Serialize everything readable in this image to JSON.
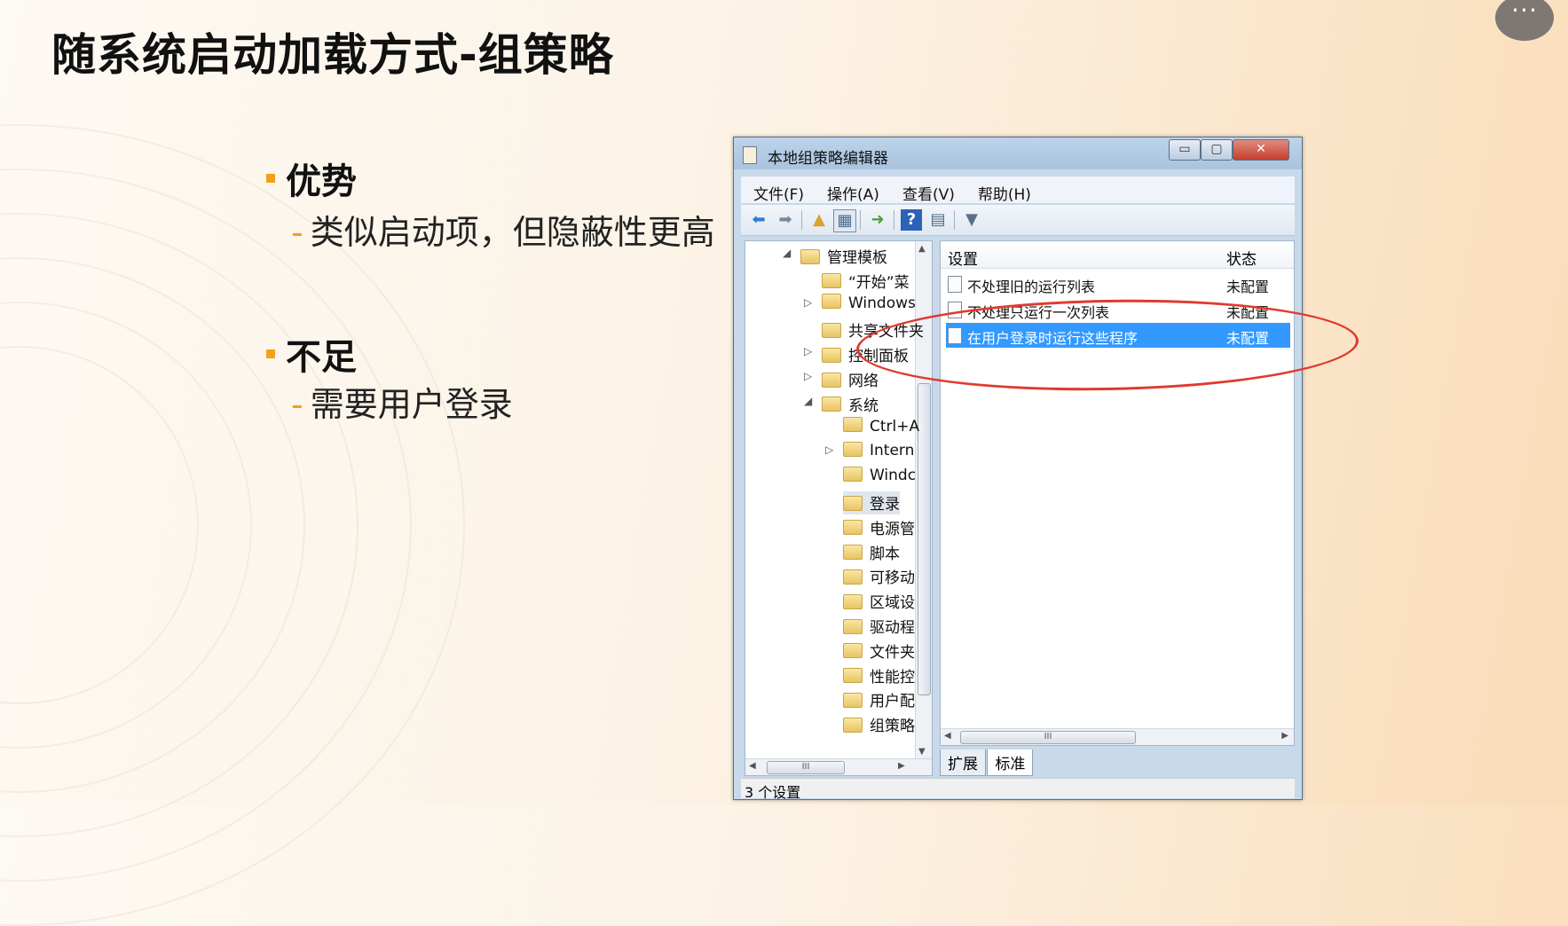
{
  "slide": {
    "title": "随系统启动加载方式-组策略",
    "more_button": "···",
    "sections": [
      {
        "heading": "优势",
        "items": [
          "类似启动项，但隐蔽性更高"
        ]
      },
      {
        "heading": "不足",
        "items": [
          "需要用户登录"
        ]
      }
    ]
  },
  "window": {
    "title": "本地组策略编辑器",
    "controls": {
      "min": "▭",
      "max": "▢",
      "close": "✕"
    },
    "menu": [
      "文件(F)",
      "操作(A)",
      "查看(V)",
      "帮助(H)"
    ],
    "toolbar_icons": [
      "back-arrow-icon",
      "forward-arrow-icon",
      "up-folder-icon",
      "show-hide-tree-icon",
      "export-list-icon",
      "help-icon",
      "properties-icon",
      "filter-icon"
    ],
    "tree": [
      {
        "label": "管理模板",
        "level": 0,
        "arrow": "◢"
      },
      {
        "label": "“开始”菜",
        "level": 1,
        "arrow": ""
      },
      {
        "label": "Windows",
        "level": 1,
        "arrow": "▷"
      },
      {
        "label": "共享文件夹",
        "level": 1,
        "arrow": ""
      },
      {
        "label": "控制面板",
        "level": 1,
        "arrow": "▷"
      },
      {
        "label": "网络",
        "level": 1,
        "arrow": "▷"
      },
      {
        "label": "系统",
        "level": 1,
        "arrow": "◢"
      },
      {
        "label": "Ctrl+A",
        "level": 2,
        "arrow": ""
      },
      {
        "label": "Intern",
        "level": 2,
        "arrow": "▷"
      },
      {
        "label": "Windc",
        "level": 2,
        "arrow": ""
      },
      {
        "label": "登录",
        "level": 2,
        "arrow": "",
        "selected": true
      },
      {
        "label": "电源管",
        "level": 2,
        "arrow": ""
      },
      {
        "label": "脚本",
        "level": 2,
        "arrow": ""
      },
      {
        "label": "可移动",
        "level": 2,
        "arrow": ""
      },
      {
        "label": "区域设",
        "level": 2,
        "arrow": ""
      },
      {
        "label": "驱动程",
        "level": 2,
        "arrow": ""
      },
      {
        "label": "文件夹",
        "level": 2,
        "arrow": ""
      },
      {
        "label": "性能控",
        "level": 2,
        "arrow": ""
      },
      {
        "label": "用户配",
        "level": 2,
        "arrow": ""
      },
      {
        "label": "组策略",
        "level": 2,
        "arrow": ""
      }
    ],
    "list": {
      "col_setting": "设置",
      "col_state": "状态",
      "rows": [
        {
          "name": "不处理旧的运行列表",
          "state": "未配置"
        },
        {
          "name": "不处理只运行一次列表",
          "state": "未配置"
        },
        {
          "name": "在用户登录时运行这些程序",
          "state": "未配置",
          "selected": true
        }
      ]
    },
    "scroll_grip": "III",
    "tabs": [
      "扩展",
      "标准"
    ],
    "status": "3 个设置"
  }
}
